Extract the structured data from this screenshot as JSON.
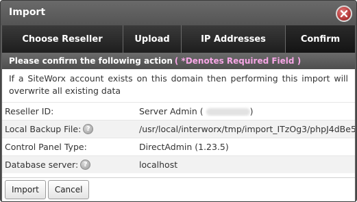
{
  "dialog": {
    "title": "Import",
    "close_icon": "close-icon",
    "colors": {
      "titlebar": "#5c5c5c",
      "close_button": "#b53a3a",
      "required_note": "#f7a6e6"
    }
  },
  "tabs": [
    {
      "label": "Choose Reseller",
      "active": false
    },
    {
      "label": "Upload",
      "active": false
    },
    {
      "label": "IP Addresses",
      "active": false
    },
    {
      "label": "Confirm",
      "active": true
    }
  ],
  "section": {
    "header": "Please confirm the following action",
    "required_note": "( *Denotes Required Field )"
  },
  "warning": "If a SiteWorx account exists on this domain then performing this import will overwrite all existing data",
  "rows": [
    {
      "label": "Reseller ID:",
      "value": "Server Admin (",
      "value_suffix": ")",
      "help": false
    },
    {
      "label": "Local Backup File:",
      "value": "/usr/local/interworx/tmp/import_ITzOg3/phpJ4dBe5",
      "help": true
    },
    {
      "label": "Control Panel Type:",
      "value": "DirectAdmin (1.23.5)",
      "help": false
    },
    {
      "label": "Database server:",
      "value": "localhost",
      "help": true
    }
  ],
  "help_icon": "question-icon",
  "buttons": {
    "import": "Import",
    "cancel": "Cancel"
  }
}
